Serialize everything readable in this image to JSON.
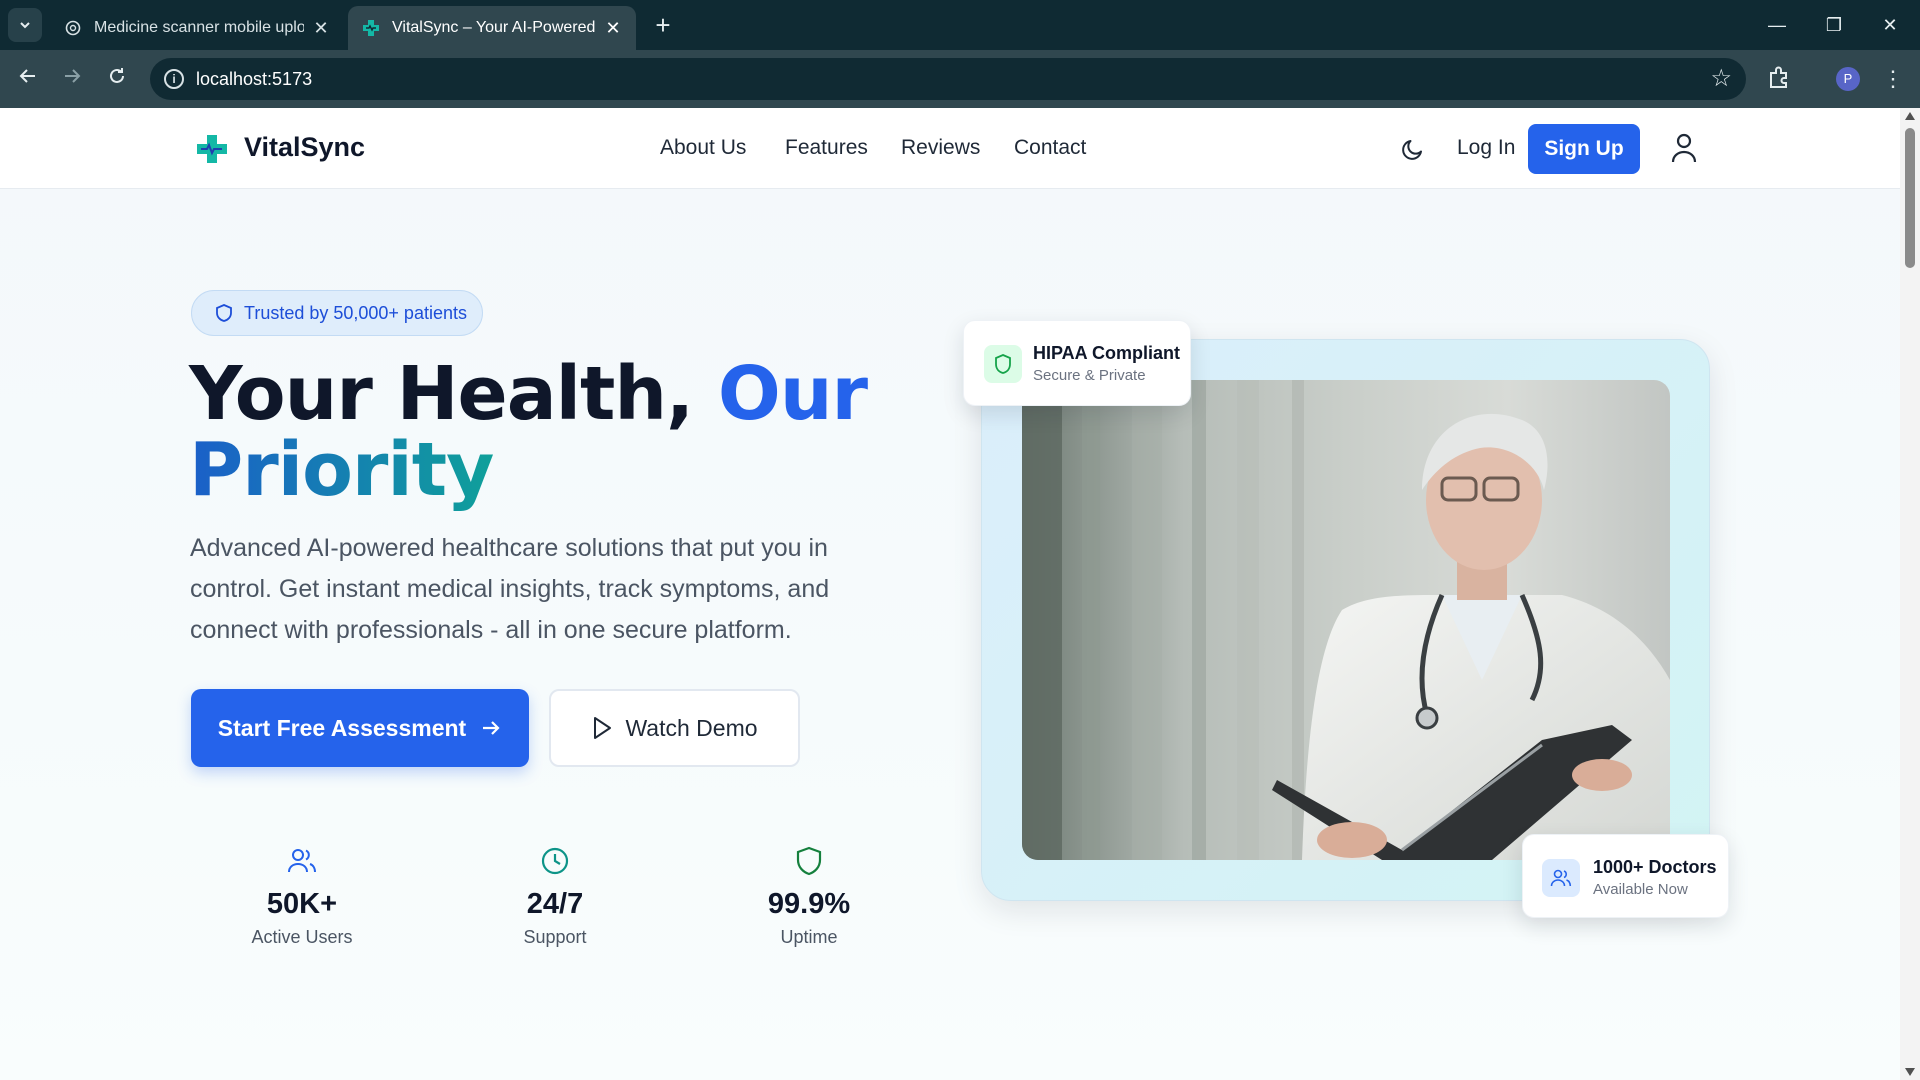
{
  "browser": {
    "tabs": [
      {
        "title": "Medicine scanner mobile uploa",
        "active": false
      },
      {
        "title": "VitalSync – Your AI-Powered He",
        "active": true
      }
    ],
    "url": "localhost:5173",
    "profile_initial": "P",
    "new_tab_glyph": "+",
    "close_glyph": "✕",
    "window_controls": {
      "minimize": "—",
      "restore": "❐",
      "close": "✕"
    }
  },
  "header": {
    "brand": "VitalSync",
    "nav": [
      "About Us",
      "Features",
      "Reviews",
      "Contact"
    ],
    "login": "Log In",
    "signup": "Sign Up"
  },
  "hero": {
    "badge": "Trusted by 50,000+ patients",
    "title_part1": "Your Health, ",
    "title_part2": "Our",
    "title_part3": "Priority",
    "subtitle": "Advanced AI-powered healthcare solutions that put you in control. Get instant medical insights, track symptoms, and connect with professionals - all in one secure platform.",
    "cta_primary": "Start Free Assessment",
    "cta_secondary": "Watch Demo"
  },
  "stats": [
    {
      "value": "50K+",
      "label": "Active Users",
      "icon": "users-icon"
    },
    {
      "value": "24/7",
      "label": "Support",
      "icon": "clock-icon"
    },
    {
      "value": "99.9%",
      "label": "Uptime",
      "icon": "shield-icon"
    }
  ],
  "cards": {
    "hipaa": {
      "title": "HIPAA Compliant",
      "subtitle": "Secure & Private"
    },
    "doctors": {
      "title": "1000+ Doctors",
      "subtitle": "Available Now"
    }
  },
  "colors": {
    "primary": "#2563eb",
    "teal": "#0d9488",
    "browser_dark": "#0f2a33",
    "browser_bar": "#30474f"
  }
}
